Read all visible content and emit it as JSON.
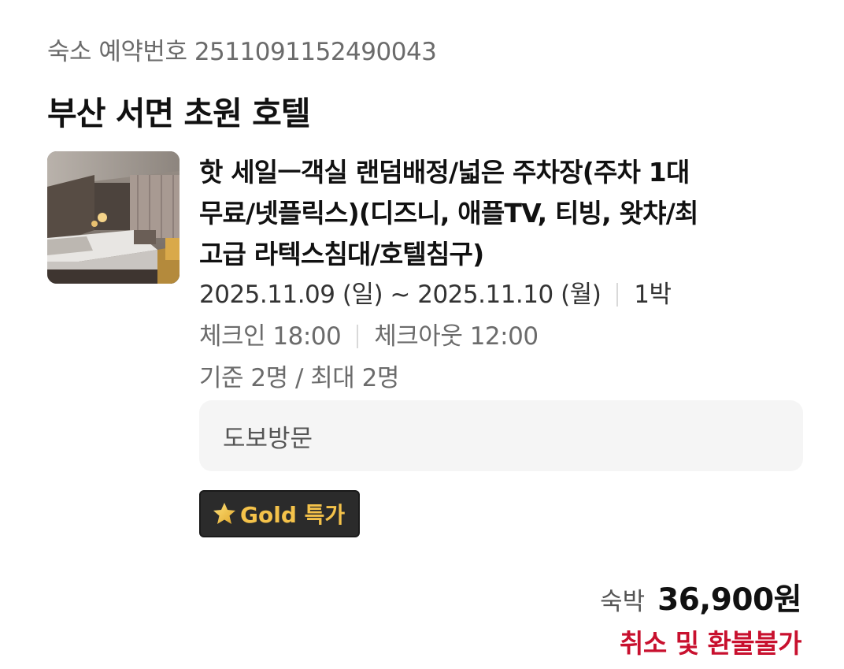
{
  "booking": {
    "number_label": "숙소 예약번호 2511091152490043"
  },
  "hotel": {
    "name": "부산 서면 초원 호텔"
  },
  "room": {
    "name_line1": "핫 세일ㅡ객실 랜덤배정/넓은 주차장(주차 1대",
    "name_line2": "무료/넷플릭스)(디즈니, 애플TV, 티빙, 왓챠/최",
    "name_line3": "고급 라텍스침대/호텔침구)"
  },
  "stay": {
    "dates": "2025.11.09 (일) ~ 2025.11.10 (월)",
    "nights": "1박",
    "checkin": "체크인 18:00",
    "checkout": "체크아웃 12:00",
    "guests": "기준 2명 / 최대 2명"
  },
  "visit": {
    "type": "도보방문"
  },
  "badge": {
    "label": "Gold 특가",
    "color": "#f4c24a",
    "icon": "star-icon"
  },
  "price": {
    "label": "숙박",
    "amount": "36,900원"
  },
  "refund": {
    "text": "취소 및 환불불가",
    "color": "#c8102e"
  }
}
